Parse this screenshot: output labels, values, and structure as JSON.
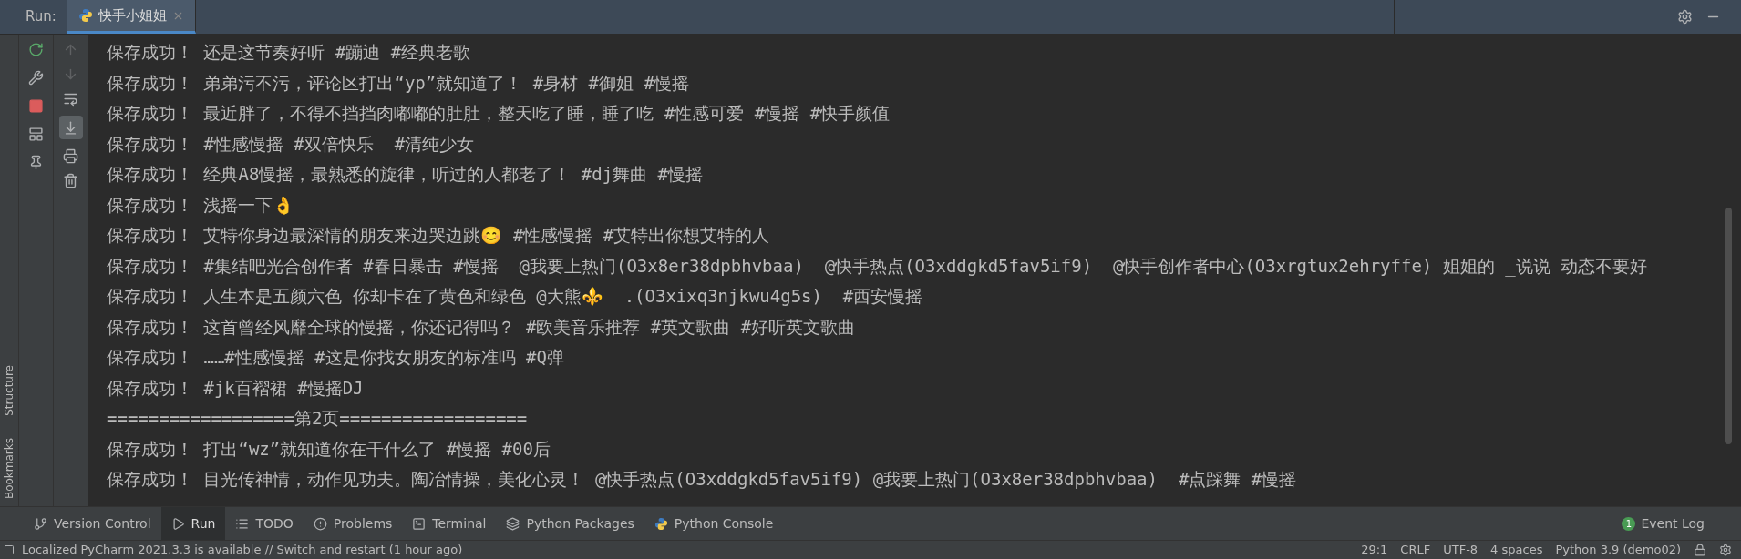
{
  "run_panel": {
    "label": "Run:",
    "tabs": [
      {
        "title": "快手小姐姐",
        "selected": true
      }
    ]
  },
  "console_toolbar": {
    "scroll_to_end": {
      "on": true
    }
  },
  "side_stripe": [
    "Structure",
    "Bookmarks"
  ],
  "console": {
    "lines": [
      "保存成功！ 还是这节奏好听 #蹦迪 #经典老歌",
      "保存成功！ 弟弟污不污，评论区打出“yp”就知道了！ #身材 #御姐 #慢摇",
      "保存成功！ 最近胖了，不得不挡挡肉嘟嘟的肚肚，整天吃了睡，睡了吃 #性感可爱 #慢摇 #快手颜值",
      "保存成功！ #性感慢摇 #双倍快乐  #清纯少女",
      "保存成功！ 经典A8慢摇，最熟悉的旋律，听过的人都老了！ #dj舞曲 #慢摇",
      "保存成功！ 浅摇一下👌",
      "保存成功！ 艾特你身边最深情的朋友来边哭边跳😊 #性感慢摇 #艾特出你想艾特的人",
      "保存成功！ #集结吧光合创作者 #春日暴击 #慢摇  @我要上热门(O3x8er38dpbhvbaa)  @快手热点(O3xddgkd5fav5if9)  @快手创作者中心(O3xrgtux2ehryffe) 姐姐的 _说说 动态不要好",
      "保存成功！ 人生本是五颜六色 你却卡在了黄色和绿色 @大熊⚜️  .(O3xixq3njkwu4g5s)  #西安慢摇",
      "保存成功！ 这首曾经风靡全球的慢摇，你还记得吗？ #欧美音乐推荐 #英文歌曲 #好听英文歌曲",
      "保存成功！ ……#性感慢摇 #这是你找女朋友的标准吗 #Q弹",
      "保存成功！ #jk百褶裙 #慢摇DJ",
      "==================第2页==================",
      "保存成功！ 打出“wz”就知道你在干什么了 #慢摇 #00后",
      "保存成功！ 目光传神情，动作见功夫。陶冶情操，美化心灵！ @快手热点(O3xddgkd5fav5if9) @我要上热门(O3x8er38dpbhvbaa)  #点踩舞 #慢摇"
    ]
  },
  "bottom_tabs": [
    {
      "label": "Version Control",
      "selected": false
    },
    {
      "label": "Run",
      "selected": true
    },
    {
      "label": "TODO",
      "selected": false
    },
    {
      "label": "Problems",
      "selected": false
    },
    {
      "label": "Terminal",
      "selected": false
    },
    {
      "label": "Python Packages",
      "selected": false
    },
    {
      "label": "Python Console",
      "selected": false
    }
  ],
  "event_log": {
    "count": "1",
    "label": "Event Log"
  },
  "status_bar": {
    "message": "Localized PyCharm 2021.3.3 is available // Switch and restart (1 hour ago)",
    "items": [
      "29:1",
      "CRLF",
      "UTF-8",
      "4 spaces",
      "Python 3.9 (demo02)"
    ]
  }
}
